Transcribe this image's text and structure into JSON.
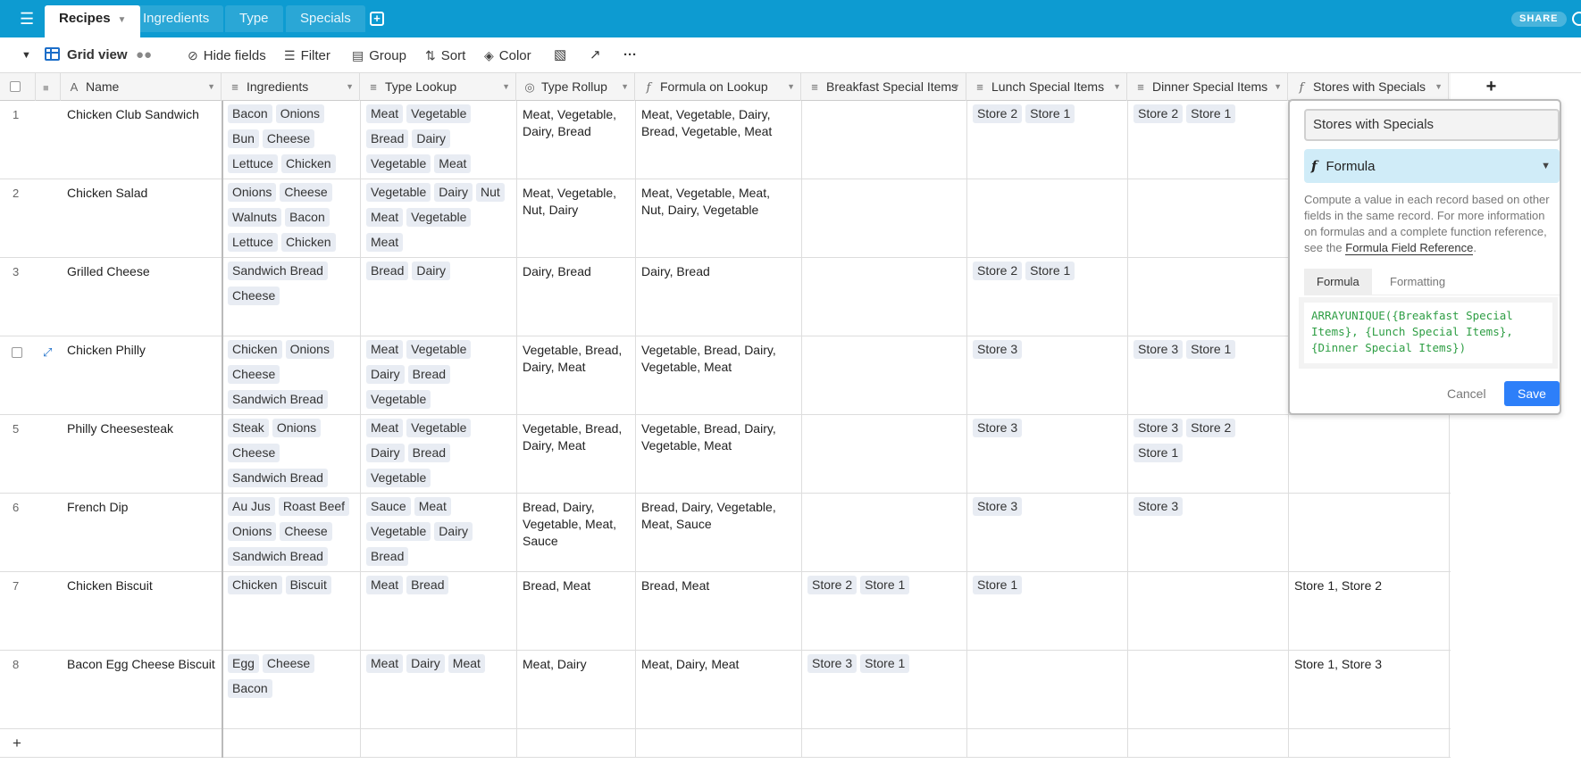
{
  "tabs": [
    {
      "label": "Recipes"
    },
    {
      "label": "Ingredients"
    },
    {
      "label": "Type"
    },
    {
      "label": "Specials"
    }
  ],
  "share_label": "SHARE",
  "toolbar": {
    "view_name": "Grid view",
    "hide_fields": "Hide fields",
    "filter": "Filter",
    "group": "Group",
    "sort": "Sort",
    "color": "Color"
  },
  "columns": [
    {
      "label": "Name"
    },
    {
      "label": "Ingredients"
    },
    {
      "label": "Type Lookup"
    },
    {
      "label": "Type Rollup"
    },
    {
      "label": "Formula on Lookup"
    },
    {
      "label": "Breakfast Special Items"
    },
    {
      "label": "Lunch Special Items"
    },
    {
      "label": "Dinner Special Items"
    },
    {
      "label": "Stores with Specials"
    }
  ],
  "rows": [
    {
      "num": "1",
      "name": "Chicken Club Sandwich",
      "ingredients": [
        "Bacon",
        "Onions",
        "Bun",
        "Cheese",
        "Lettuce",
        "Chicken"
      ],
      "type_lookup": [
        "Meat",
        "Vegetable",
        "Bread",
        "Dairy",
        "Vegetable",
        "Meat"
      ],
      "type_rollup": "Meat, Vegetable, Dairy, Bread",
      "formula_lookup": "Meat, Vegetable, Dairy, Bread, Vegetable, Meat",
      "breakfast": [],
      "lunch": [
        "Store 2",
        "Store 1"
      ],
      "dinner": [
        "Store 2",
        "Store 1"
      ],
      "stores": ""
    },
    {
      "num": "2",
      "name": "Chicken Salad",
      "ingredients": [
        "Onions",
        "Cheese",
        "Walnuts",
        "Bacon",
        "Lettuce",
        "Chicken"
      ],
      "type_lookup": [
        "Vegetable",
        "Dairy",
        "Nut",
        "Meat",
        "Vegetable",
        "Meat"
      ],
      "type_rollup": "Meat, Vegetable, Nut, Dairy",
      "formula_lookup": "Meat, Vegetable, Meat, Nut, Dairy, Vegetable",
      "breakfast": [],
      "lunch": [],
      "dinner": [],
      "stores": ""
    },
    {
      "num": "3",
      "name": "Grilled Cheese",
      "ingredients": [
        "Sandwich Bread",
        "Cheese"
      ],
      "type_lookup": [
        "Bread",
        "Dairy"
      ],
      "type_rollup": "Dairy, Bread",
      "formula_lookup": "Dairy, Bread",
      "breakfast": [],
      "lunch": [
        "Store 2",
        "Store 1"
      ],
      "dinner": [],
      "stores": ""
    },
    {
      "num": "",
      "name": "Chicken Philly",
      "ingredients": [
        "Chicken",
        "Onions",
        "Cheese",
        "Sandwich Bread"
      ],
      "type_lookup": [
        "Meat",
        "Vegetable",
        "Dairy",
        "Bread",
        "Vegetable"
      ],
      "type_rollup": "Vegetable, Bread, Dairy, Meat",
      "formula_lookup": "Vegetable, Bread, Dairy, Vegetable, Meat",
      "breakfast": [],
      "lunch": [
        "Store 3"
      ],
      "dinner": [
        "Store 3",
        "Store 1"
      ],
      "stores": ""
    },
    {
      "num": "5",
      "name": "Philly Cheesesteak",
      "ingredients": [
        "Steak",
        "Onions",
        "Cheese",
        "Sandwich Bread"
      ],
      "type_lookup": [
        "Meat",
        "Vegetable",
        "Dairy",
        "Bread",
        "Vegetable"
      ],
      "type_rollup": "Vegetable, Bread, Dairy, Meat",
      "formula_lookup": "Vegetable, Bread, Dairy, Vegetable, Meat",
      "breakfast": [],
      "lunch": [
        "Store 3"
      ],
      "dinner": [
        "Store 3",
        "Store 2",
        "Store 1"
      ],
      "stores": ""
    },
    {
      "num": "6",
      "name": "French Dip",
      "ingredients": [
        "Au Jus",
        "Roast Beef",
        "Onions",
        "Cheese",
        "Sandwich Bread"
      ],
      "type_lookup": [
        "Sauce",
        "Meat",
        "Vegetable",
        "Dairy",
        "Bread"
      ],
      "type_rollup": "Bread, Dairy, Vegetable, Meat, Sauce",
      "formula_lookup": "Bread, Dairy, Vegetable, Meat, Sauce",
      "breakfast": [],
      "lunch": [
        "Store 3"
      ],
      "dinner": [
        "Store 3"
      ],
      "stores": ""
    },
    {
      "num": "7",
      "name": "Chicken Biscuit",
      "ingredients": [
        "Chicken",
        "Biscuit"
      ],
      "type_lookup": [
        "Meat",
        "Bread"
      ],
      "type_rollup": "Bread, Meat",
      "formula_lookup": "Bread, Meat",
      "breakfast": [
        "Store 2",
        "Store 1"
      ],
      "lunch": [
        "Store 1"
      ],
      "dinner": [],
      "stores": "Store 1, Store 2"
    },
    {
      "num": "8",
      "name": "Bacon Egg Cheese Biscuit",
      "ingredients": [
        "Egg",
        "Cheese",
        "Bacon"
      ],
      "type_lookup": [
        "Meat",
        "Dairy",
        "Meat"
      ],
      "type_rollup": "Meat, Dairy",
      "formula_lookup": "Meat, Dairy, Meat",
      "breakfast": [
        "Store 3",
        "Store 1"
      ],
      "lunch": [],
      "dinner": [],
      "stores": "Store 1, Store 3"
    }
  ],
  "panel": {
    "field_name": "Stores with Specials",
    "field_type": "Formula",
    "description": "Compute a value in each record based on other fields in the same record. For more information on formulas and a complete function reference, see the",
    "reference_link": "Formula Field Reference",
    "tab_formula": "Formula",
    "tab_formatting": "Formatting",
    "formula": "ARRAYUNIQUE({Breakfast Special Items}, {Lunch Special Items}, {Dinner Special Items})",
    "cancel": "Cancel",
    "save": "Save"
  },
  "colors": {
    "topbar": "#0d9bd1",
    "save_button": "#2d7ff9",
    "pill": "#e8ecf3",
    "formula_text": "#2e9e44"
  }
}
